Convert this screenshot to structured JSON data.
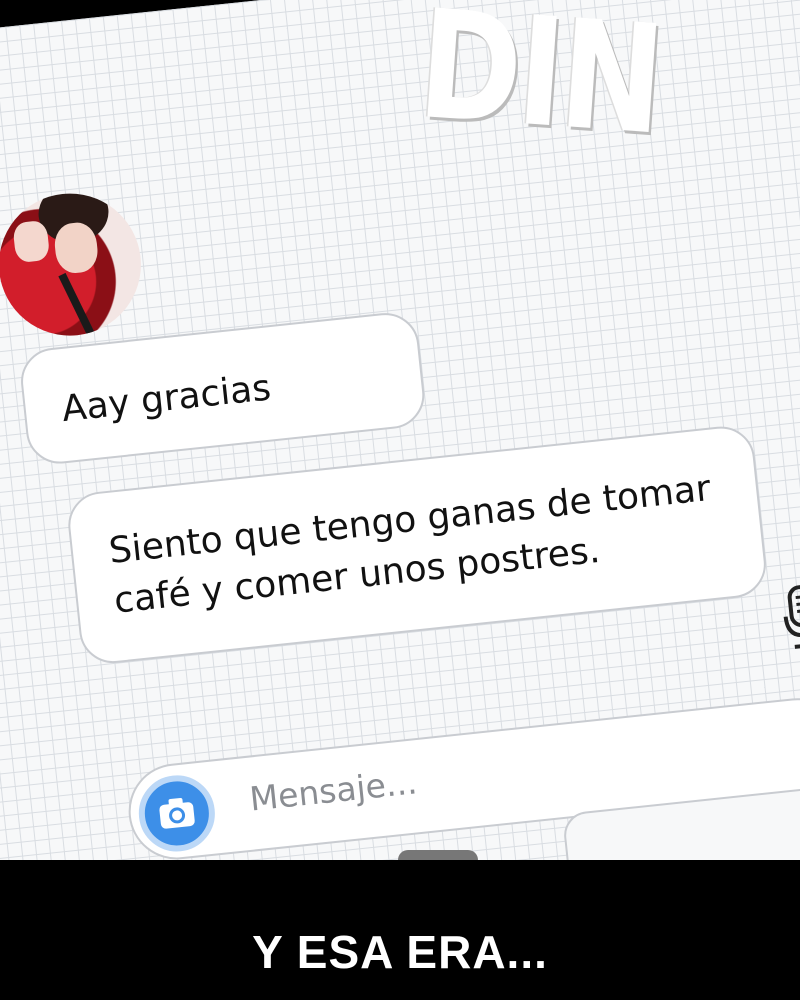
{
  "sound_effect": "DIN",
  "chat": {
    "contact_avatar": "contact-avatar",
    "messages": [
      {
        "text": "Aay gracias"
      },
      {
        "text": "Siento que tengo ganas de tomar café y comer unos postres."
      }
    ]
  },
  "composer": {
    "placeholder": "Mensaje...",
    "camera_icon": "camera-icon",
    "mic_icon": "microphone-icon"
  },
  "caption": "Y ESA ERA...",
  "colors": {
    "camera_button": "#3d8fe8",
    "bubble_border": "#c9ccd1",
    "screen_bg": "#f7f8f9"
  }
}
